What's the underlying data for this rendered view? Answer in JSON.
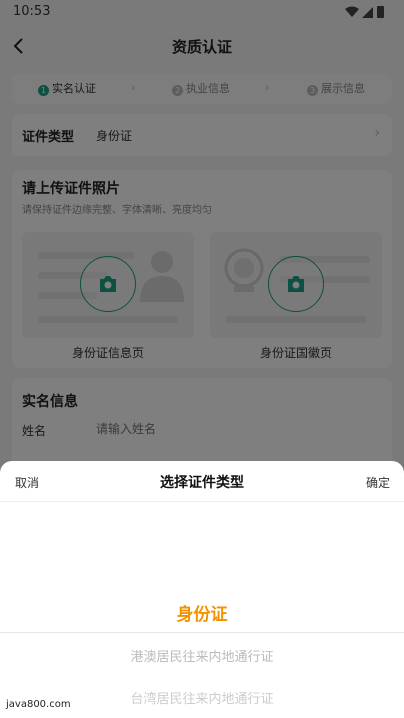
{
  "status": {
    "time": "10:53"
  },
  "nav": {
    "title": "资质认证"
  },
  "steps": [
    {
      "index": "1",
      "label": "实名认证"
    },
    {
      "index": "2",
      "label": "执业信息"
    },
    {
      "index": "3",
      "label": "展示信息"
    }
  ],
  "id_type": {
    "label": "证件类型",
    "value": "身份证"
  },
  "upload": {
    "title": "请上传证件照片",
    "subtitle": "请保持证件边缘完整、字体清晰、亮度均匀",
    "front_label": "身份证信息页",
    "back_label": "身份证国徽页"
  },
  "realname": {
    "title": "实名信息",
    "name_label": "姓名",
    "name_placeholder": "请输入姓名"
  },
  "picker": {
    "cancel": "取消",
    "title": "选择证件类型",
    "confirm": "确定",
    "selected": "身份证",
    "options": [
      "港澳居民往来内地通行证",
      "台湾居民往来内地通行证"
    ]
  },
  "watermark": "java800.com",
  "colors": {
    "accent": "#1aa088",
    "highlight": "#f39200"
  }
}
